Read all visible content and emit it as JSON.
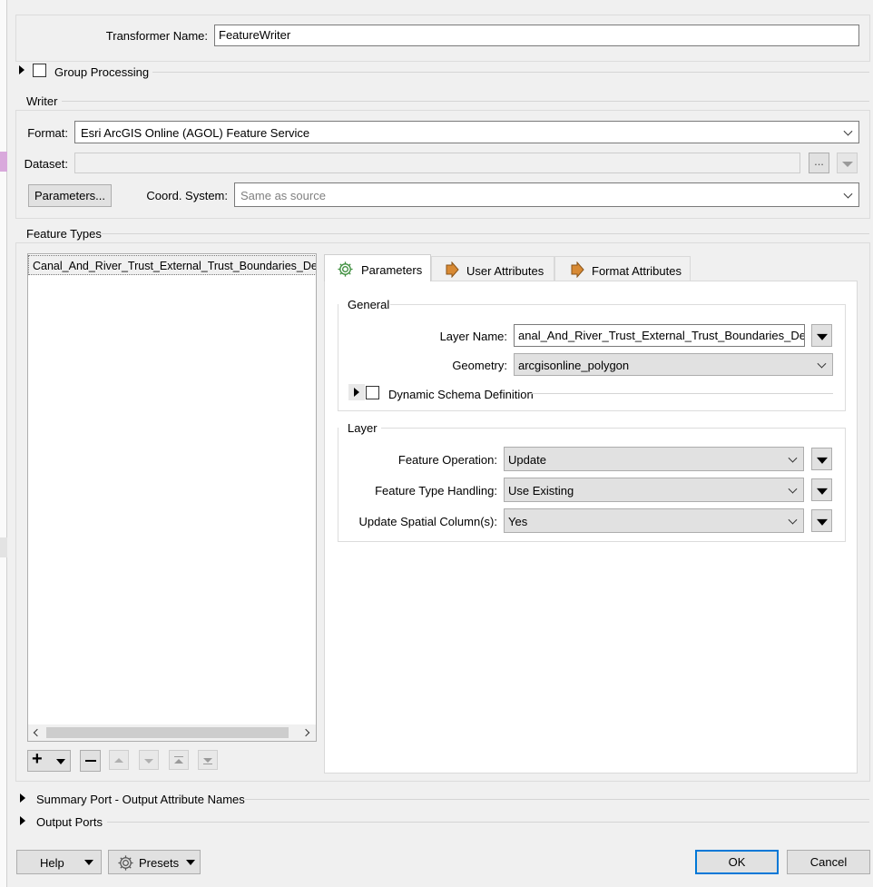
{
  "transformer": {
    "label": "Transformer Name:",
    "value": "FeatureWriter"
  },
  "group_processing": {
    "label": "Group Processing"
  },
  "writer": {
    "title": "Writer",
    "format_label": "Format:",
    "format_value": "Esri ArcGIS Online (AGOL) Feature Service",
    "dataset_label": "Dataset:",
    "dataset_value": "",
    "browse_label": "...",
    "parameters_label": "Parameters...",
    "coord_label": "Coord. System:",
    "coord_value": "Same as source"
  },
  "feature_types": {
    "title": "Feature Types",
    "items": [
      "Canal_And_River_Trust_External_Trust_Boundaries_Detailed"
    ],
    "toolbar": {
      "add": "+",
      "remove": "—"
    }
  },
  "tabs": [
    {
      "label": "Parameters",
      "icon": "gear-icon"
    },
    {
      "label": "User Attributes",
      "icon": "arrow-right-icon"
    },
    {
      "label": "Format Attributes",
      "icon": "arrow-right-icon"
    }
  ],
  "general": {
    "title": "General",
    "layer_name_label": "Layer Name:",
    "layer_name_value": "anal_And_River_Trust_External_Trust_Boundaries_Detailed",
    "geometry_label": "Geometry:",
    "geometry_value": "arcgisonline_polygon",
    "dynamic_schema_label": "Dynamic Schema Definition"
  },
  "layer": {
    "title": "Layer",
    "feature_operation_label": "Feature Operation:",
    "feature_operation_value": "Update",
    "feature_type_handling_label": "Feature Type Handling:",
    "feature_type_handling_value": "Use Existing",
    "update_spatial_label": "Update Spatial Column(s):",
    "update_spatial_value": "Yes"
  },
  "summary_port": {
    "label": "Summary Port - Output Attribute Names"
  },
  "output_ports": {
    "label": "Output Ports"
  },
  "footer": {
    "help": "Help",
    "presets": "Presets",
    "ok": "OK",
    "cancel": "Cancel"
  }
}
